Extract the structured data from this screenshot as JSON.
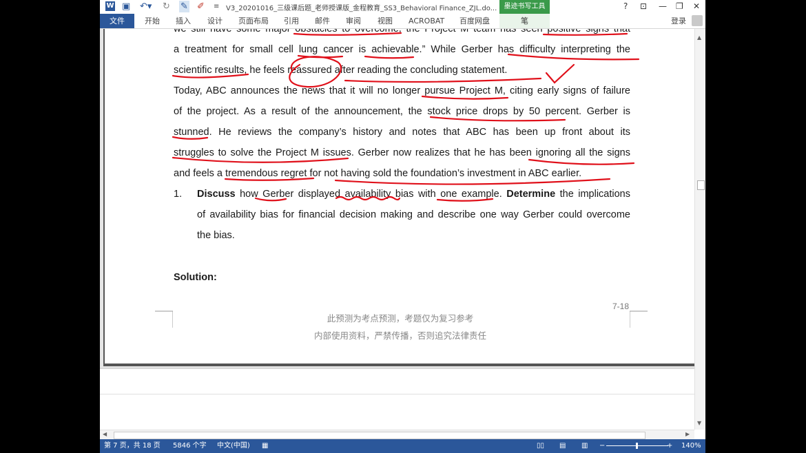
{
  "window": {
    "title": "V3_20201016_三级课后题_老师授课版_金程教育_SS3_Behavioral Finance_ZJL.do...",
    "contextual_tab": "墨迹书写工具",
    "help": "?",
    "controls": [
      "restore-ribbon",
      "minimize",
      "restore",
      "close"
    ]
  },
  "quick_access": [
    {
      "name": "save-icon",
      "glyph": "💾"
    },
    {
      "name": "undo-icon",
      "glyph": "↶"
    },
    {
      "name": "redo-icon",
      "glyph": "↻"
    },
    {
      "name": "pen-icon",
      "glyph": "✎"
    },
    {
      "name": "eraser-icon",
      "glyph": "✐"
    },
    {
      "name": "customize-icon",
      "glyph": "="
    }
  ],
  "ribbon": {
    "file": "文件",
    "tabs": [
      "开始",
      "插入",
      "设计",
      "页面布局",
      "引用",
      "邮件",
      "审阅",
      "视图",
      "ACROBAT",
      "百度网盘"
    ],
    "pen_tab": "笔",
    "login": "登录"
  },
  "document": {
    "lines": [
      "we still have some major obstacles to overcome, the Project M team has seen positive signs that",
      "a treatment for small cell lung cancer is achievable.” While Gerber has difficulty interpreting the",
      "scientific results, he feels reassured after reading the concluding statement.",
      "Today, ABC announces the news that it will no longer pursue Project M, citing early signs of failure",
      "of the project. As a result of the announcement, the stock price drops by 50 percent. Gerber is",
      "stunned. He reviews the company’s history and notes that ABC has been up front about its",
      "struggles to solve the Project M issues. Gerber now realizes that he has been ignoring all the signs",
      "and feels a tremendous regret for not having sold the foundation’s investment in ABC earlier."
    ],
    "question": {
      "number": "1.",
      "bold1": "Discuss",
      "text1": " how Gerber displayed availability bias with one example. ",
      "bold2": "Determine",
      "text2": " the implications",
      "line2": "of availability bias for financial decision making and describe one way Gerber could overcome",
      "line3": "the bias."
    },
    "solution": "Solution:",
    "page_number": "7-18",
    "footer1": "此预测为考点预测，考题仅为复习参考",
    "footer2": "内部使用资料，严禁传播，否则追究法律责任"
  },
  "status": {
    "page": "第 7 页，共 18 页",
    "words": "5846 个字",
    "language": "中文(中国)",
    "zoom": "140%"
  },
  "colors": {
    "accent": "#2b579a",
    "ink_tab": "#3a9a4a",
    "ink": "#e0101a"
  }
}
